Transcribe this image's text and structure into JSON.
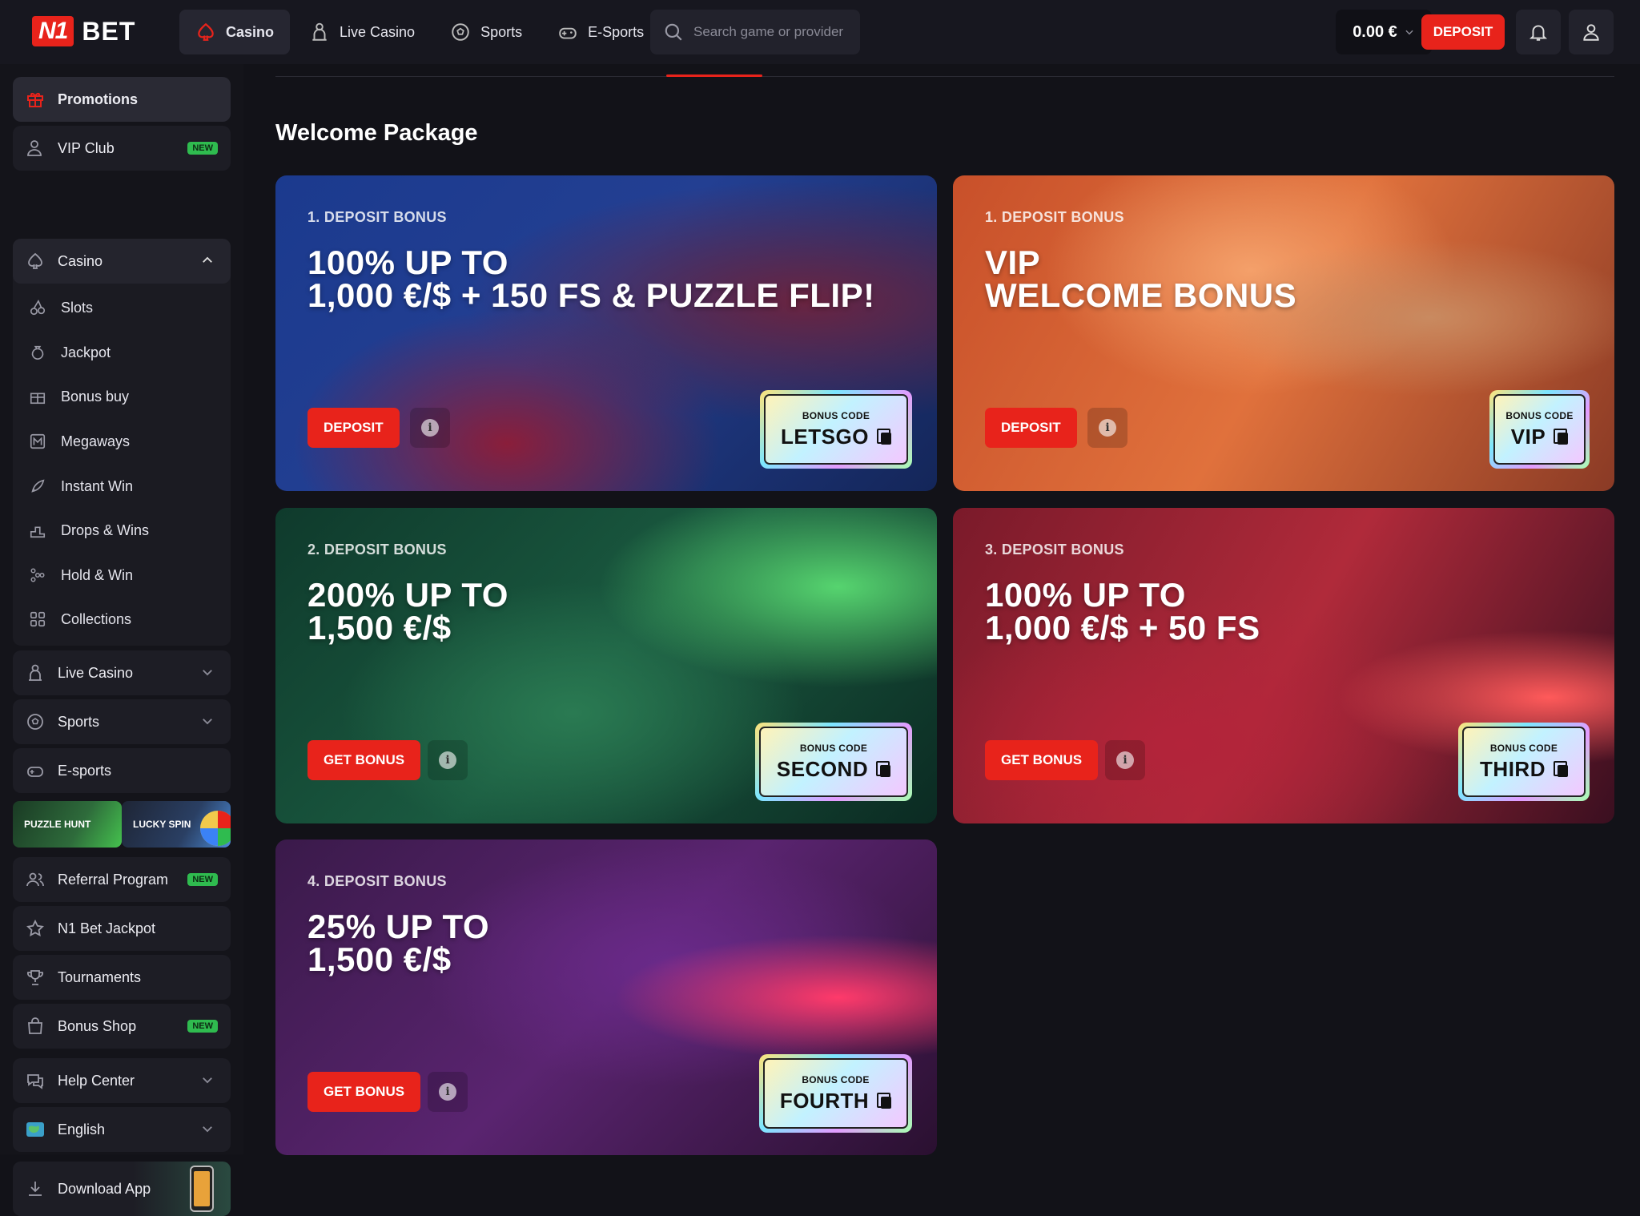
{
  "brand": {
    "logo_n1": "N1",
    "logo_bet": "BET"
  },
  "header": {
    "nav": [
      {
        "label": "Casino",
        "icon": "casino-icon",
        "active": true
      },
      {
        "label": "Live Casino",
        "icon": "live-casino-icon"
      },
      {
        "label": "Sports",
        "icon": "soccer-ball-icon"
      },
      {
        "label": "E-Sports",
        "icon": "gamepad-icon"
      }
    ],
    "search_placeholder": "Search game or provider",
    "balance": "0.00 €",
    "deposit_label": "DEPOSIT"
  },
  "sidebar": {
    "promotions": "Promotions",
    "vip_club": "VIP Club",
    "new_badge": "NEW",
    "casino": "Casino",
    "casino_sub": [
      "Slots",
      "Jackpot",
      "Bonus buy",
      "Megaways",
      "Instant Win",
      "Drops & Wins",
      "Hold & Win",
      "Collections"
    ],
    "live_casino": "Live Casino",
    "sports": "Sports",
    "esports": "E-sports",
    "puzzle_hunt": "PUZZLE HUNT",
    "lucky_spin": "LUCKY SPIN",
    "referral": "Referral Program",
    "n1_jackpot": "N1 Bet Jackpot",
    "tournaments": "Tournaments",
    "bonus_shop": "Bonus Shop",
    "help_center": "Help Center",
    "language": "English",
    "download_app": "Download App"
  },
  "main": {
    "title": "Welcome Package",
    "code_label": "BONUS CODE",
    "cards": [
      {
        "eyebrow": "1. DEPOSIT BONUS",
        "headline_1": "100% UP TO",
        "headline_2": "1,000 €/$ + 150 FS & PUZZLE FLIP!",
        "cta": "DEPOSIT",
        "code": "LETSGO"
      },
      {
        "eyebrow": "1. DEPOSIT BONUS",
        "headline_1": "VIP",
        "headline_2": "WELCOME BONUS",
        "cta": "DEPOSIT",
        "code": "VIP"
      },
      {
        "eyebrow": "2. DEPOSIT BONUS",
        "headline_1": "200% UP TO",
        "headline_2": "1,500 €/$",
        "cta": "GET BONUS",
        "code": "SECOND"
      },
      {
        "eyebrow": "3. DEPOSIT BONUS",
        "headline_1": "100% UP TO",
        "headline_2": "1,000 €/$ + 50 FS",
        "cta": "GET BONUS",
        "code": "THIRD"
      },
      {
        "eyebrow": "4. DEPOSIT BONUS",
        "headline_1": "25% UP TO",
        "headline_2": "1,500 €/$",
        "cta": "GET BONUS",
        "code": "FOURTH"
      }
    ]
  },
  "colors": {
    "accent": "#e8231b",
    "bg": "#121218",
    "sidebar": "#14141a",
    "new_badge": "#2fbb4f"
  }
}
